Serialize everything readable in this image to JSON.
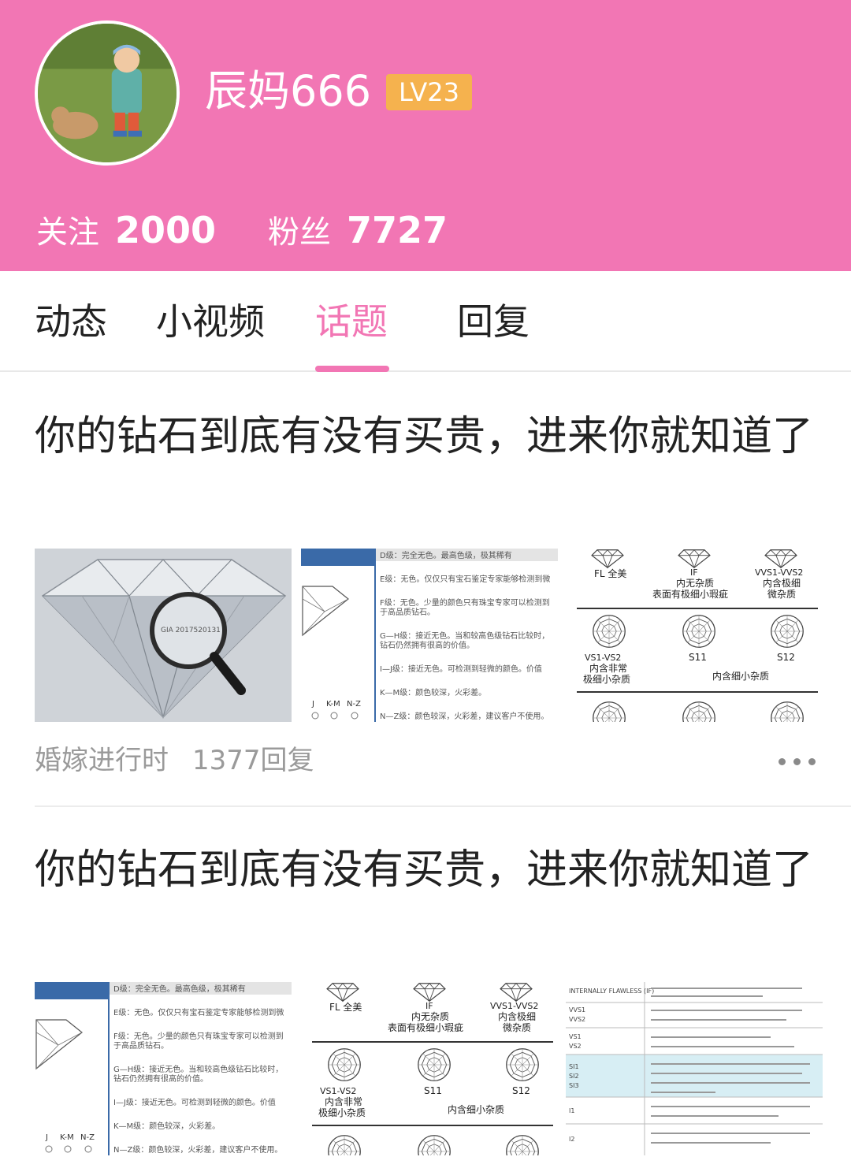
{
  "profile": {
    "username": "辰妈666",
    "level": "LV23",
    "following_label": "关注",
    "following_count": "2000",
    "fans_label": "粉丝",
    "fans_count": "7727"
  },
  "tabs": [
    {
      "label": "动态",
      "active": false
    },
    {
      "label": "小视频",
      "active": false
    },
    {
      "label": "话题",
      "active": true
    },
    {
      "label": "回复",
      "active": false
    }
  ],
  "colors": {
    "brand": "#f276b4",
    "badge": "#f5b24e",
    "meta": "#9a9a9a"
  },
  "grade_chart": {
    "fl": "FL 全美",
    "if": "IF",
    "if_desc1": "内无杂质",
    "if_desc2": "表面有极细小瑕疵",
    "vvs": "VVS1-VVS2",
    "vvs_desc1": "内含极细",
    "vvs_desc2": "微杂质",
    "vs": "VS1-VS2",
    "vs_desc1": "内含非常",
    "vs_desc2": "极细小杂质",
    "si1": "S11",
    "si2": "S12",
    "si_desc": "内含细小杂质"
  },
  "color_grades": {
    "d": "D级：完全无色。最高色级，极其稀有",
    "e": "E级：无色。仅仅只有宝石鉴定专家能够检测到微",
    "f1": "F级：无色。少量的颜色只有珠宝专家可以检测到",
    "f2": "于高品质钻石。",
    "gh1": "G—H级：接近无色。当和较高色级钻石比较时，",
    "gh2": "钻石仍然拥有很高的价值。",
    "ij": "I—J级：接近无色。可检测到轻微的颜色。价值",
    "km": "K—M级：颜色较深，火彩差。",
    "nz": "N—Z级：颜色较深，火彩差，建议客户不使用。",
    "scale_j": "J",
    "scale_km": "K-M",
    "scale_nz": "N-Z"
  },
  "loupe_text": "GIA 2017520131",
  "clarity_table": {
    "row1": "INTERNALLY FLAWLESS (IF)",
    "row2": "VVS1",
    "row2b": "VVS2",
    "row3": "VS1",
    "row3b": "VS2",
    "row4": "SI1",
    "row4b": "SI2",
    "row4c": "SI3",
    "row5": "I1",
    "row6": "I2"
  },
  "posts": [
    {
      "title": "你的钻石到底有没有买贵，进来你就知道了",
      "category": "婚嫁进行时",
      "replies": "1377回复"
    },
    {
      "title": "你的钻石到底有没有买贵，进来你就知道了"
    }
  ]
}
